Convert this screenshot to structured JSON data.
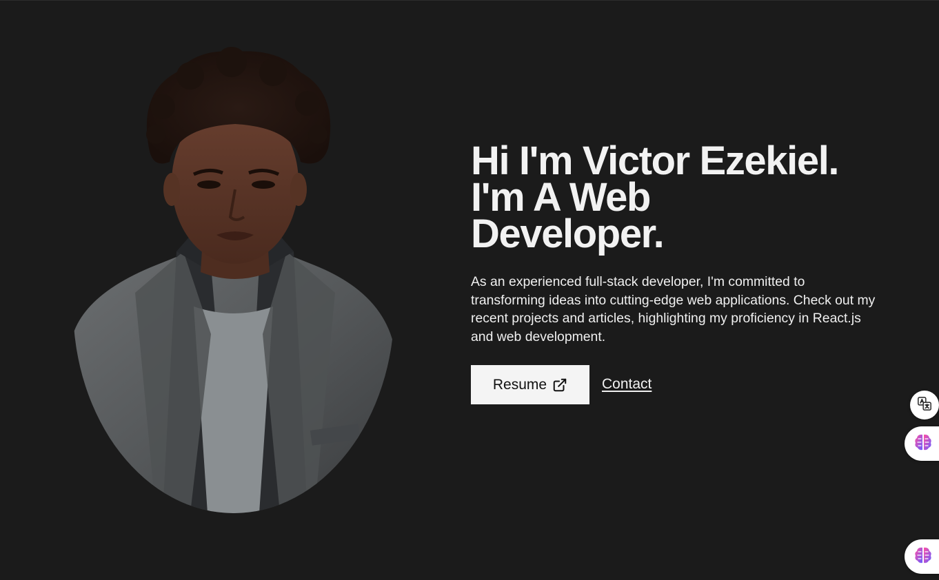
{
  "hero": {
    "heading_line1": "Hi I'm Victor Ezekiel.",
    "heading_line2": "I'm A Web",
    "heading_line3": "Developer.",
    "description": "As an experienced full-stack developer, I'm committed to transforming ideas into cutting-edge web applications. Check out my recent projects and articles, highlighting my proficiency in React.js and web development.",
    "resume_label": "Resume",
    "contact_label": "Contact"
  },
  "icons": {
    "resume": "external-link-icon",
    "translate": "translate-icon",
    "assistant": "brain-icon"
  },
  "colors": {
    "background": "#1b1b1b",
    "text": "#f2f2f2",
    "button_bg": "#f4f4f4"
  }
}
